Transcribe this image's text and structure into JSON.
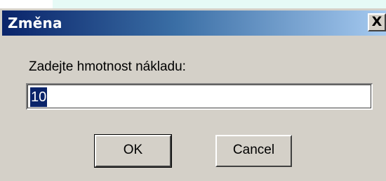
{
  "dialog": {
    "title": "Změna",
    "close_label": "X",
    "prompt": "Zadejte hmotnost nákladu:",
    "input_value": "10",
    "ok_label": "OK",
    "cancel_label": "Cancel"
  }
}
